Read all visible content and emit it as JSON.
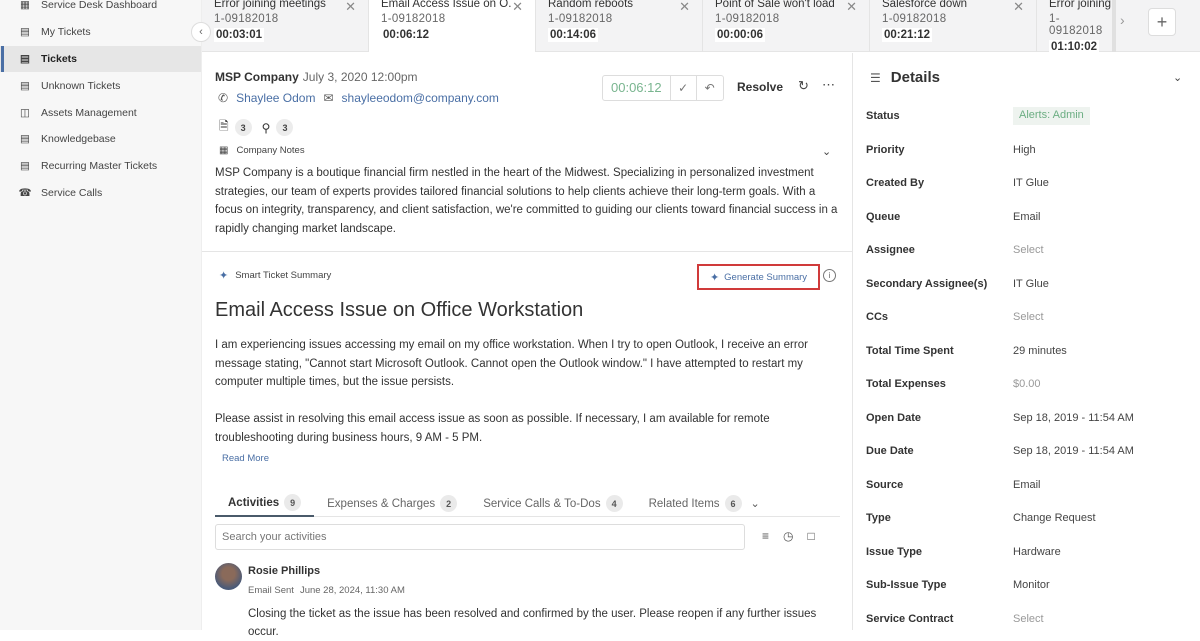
{
  "sidebar": {
    "items": [
      {
        "label": "Service Desk Dashboard",
        "icon": "dashboard-icon"
      },
      {
        "label": "My Tickets",
        "icon": "ticket-icon"
      },
      {
        "label": "Tickets",
        "icon": "ticket-icon",
        "active": true
      },
      {
        "label": "Unknown Tickets",
        "icon": "ticket-icon"
      },
      {
        "label": "Assets Management",
        "icon": "devices-icon"
      },
      {
        "label": "Knowledgebase",
        "icon": "book-icon"
      },
      {
        "label": "Recurring Master Tickets",
        "icon": "ticket-icon"
      },
      {
        "label": "Service Calls",
        "icon": "headset-icon"
      }
    ]
  },
  "tabs": [
    {
      "title": "Error joining meetings",
      "id": "1-09182018",
      "time": "00:03:01"
    },
    {
      "title": "Email Access Issue on O...",
      "id": "1-09182018",
      "time": "00:06:12",
      "active": true
    },
    {
      "title": "Random reboots",
      "id": "1-09182018",
      "time": "00:14:06"
    },
    {
      "title": "Point of Sale won't load",
      "id": "1-09182018",
      "time": "00:00:06"
    },
    {
      "title": "Salesforce down",
      "id": "1-09182018",
      "time": "00:21:12"
    },
    {
      "title": "Error joining",
      "id": "1-09182018",
      "time": "01:10:02"
    }
  ],
  "ticket": {
    "company": "MSP Company",
    "date": "July 3, 2020 12:00pm",
    "contact_name": "Shaylee Odom",
    "contact_email": "shayleeodom@company.com",
    "attachments_count": "3",
    "links_count": "3",
    "timer": "00:06:12",
    "resolve_label": "Resolve",
    "notes_heading": "Company Notes",
    "notes_text": "MSP Company is a boutique financial firm nestled in the heart of the Midwest. Specializing in personalized investment strategies, our team of experts provides tailored financial solutions to help clients achieve their long-term goals. With a focus on integrity, transparency, and client satisfaction, we're committed to guiding our clients toward financial success in a rapidly changing market landscape.",
    "smart_summary_label": "Smart Ticket Summary",
    "generate_summary_label": "Generate Summary",
    "title": "Email Access Issue on Office Workstation",
    "description_p1": "I am experiencing issues accessing my email on my office workstation. When I try to open Outlook, I receive an error message stating, \"Cannot start Microsoft Outlook. Cannot open the Outlook window.\" I have attempted to restart my computer multiple times, but the issue persists.",
    "description_p2": "Please assist in resolving this email access issue as soon as possible. If necessary, I am available for remote troubleshooting during business hours, 9 AM - 5 PM.",
    "read_more": "Read More"
  },
  "activity_tabs": [
    {
      "label": "Activities",
      "count": "9",
      "active": true
    },
    {
      "label": "Expenses & Charges",
      "count": "2"
    },
    {
      "label": "Service Calls & To-Dos",
      "count": "4"
    },
    {
      "label": "Related Items",
      "count": "6"
    }
  ],
  "activity_search": {
    "placeholder": "Search your activities"
  },
  "activity": {
    "author": "Rosie Phillips",
    "type": "Email Sent",
    "timestamp": "June 28, 2024, 11:30 AM",
    "body": "Closing the ticket as the issue has been resolved and confirmed by the user. Please reopen if any further issues occur."
  },
  "details": {
    "heading": "Details",
    "rows": [
      {
        "label": "Status",
        "value": "Alerts: Admin",
        "style": "pill"
      },
      {
        "label": "Priority",
        "value": "High"
      },
      {
        "label": "Created By",
        "value": "IT Glue"
      },
      {
        "label": "Queue",
        "value": "Email"
      },
      {
        "label": "Assignee",
        "value": "Select",
        "style": "muted"
      },
      {
        "label": "Secondary Assignee(s)",
        "value": "IT Glue"
      },
      {
        "label": "CCs",
        "value": "Select",
        "style": "muted"
      },
      {
        "label": "Total Time Spent",
        "value": "29 minutes"
      },
      {
        "label": "Total Expenses",
        "value": "$0.00",
        "style": "muted"
      },
      {
        "label": "Open Date",
        "value": "Sep 18, 2019 - 11:54 AM"
      },
      {
        "label": "Due Date",
        "value": "Sep 18, 2019 - 11:54 AM"
      },
      {
        "label": "Source",
        "value": "Email"
      },
      {
        "label": "Type",
        "value": "Change Request"
      },
      {
        "label": "Issue Type",
        "value": "Hardware"
      },
      {
        "label": "Sub-Issue Type",
        "value": "Monitor"
      },
      {
        "label": "Service Contract",
        "value": "Select",
        "style": "muted"
      }
    ]
  },
  "colors": {
    "accent": "#4a6fa5",
    "timer_green": "#79b58f",
    "highlight_red": "#d03a3a",
    "status_green": "#6cae83"
  }
}
